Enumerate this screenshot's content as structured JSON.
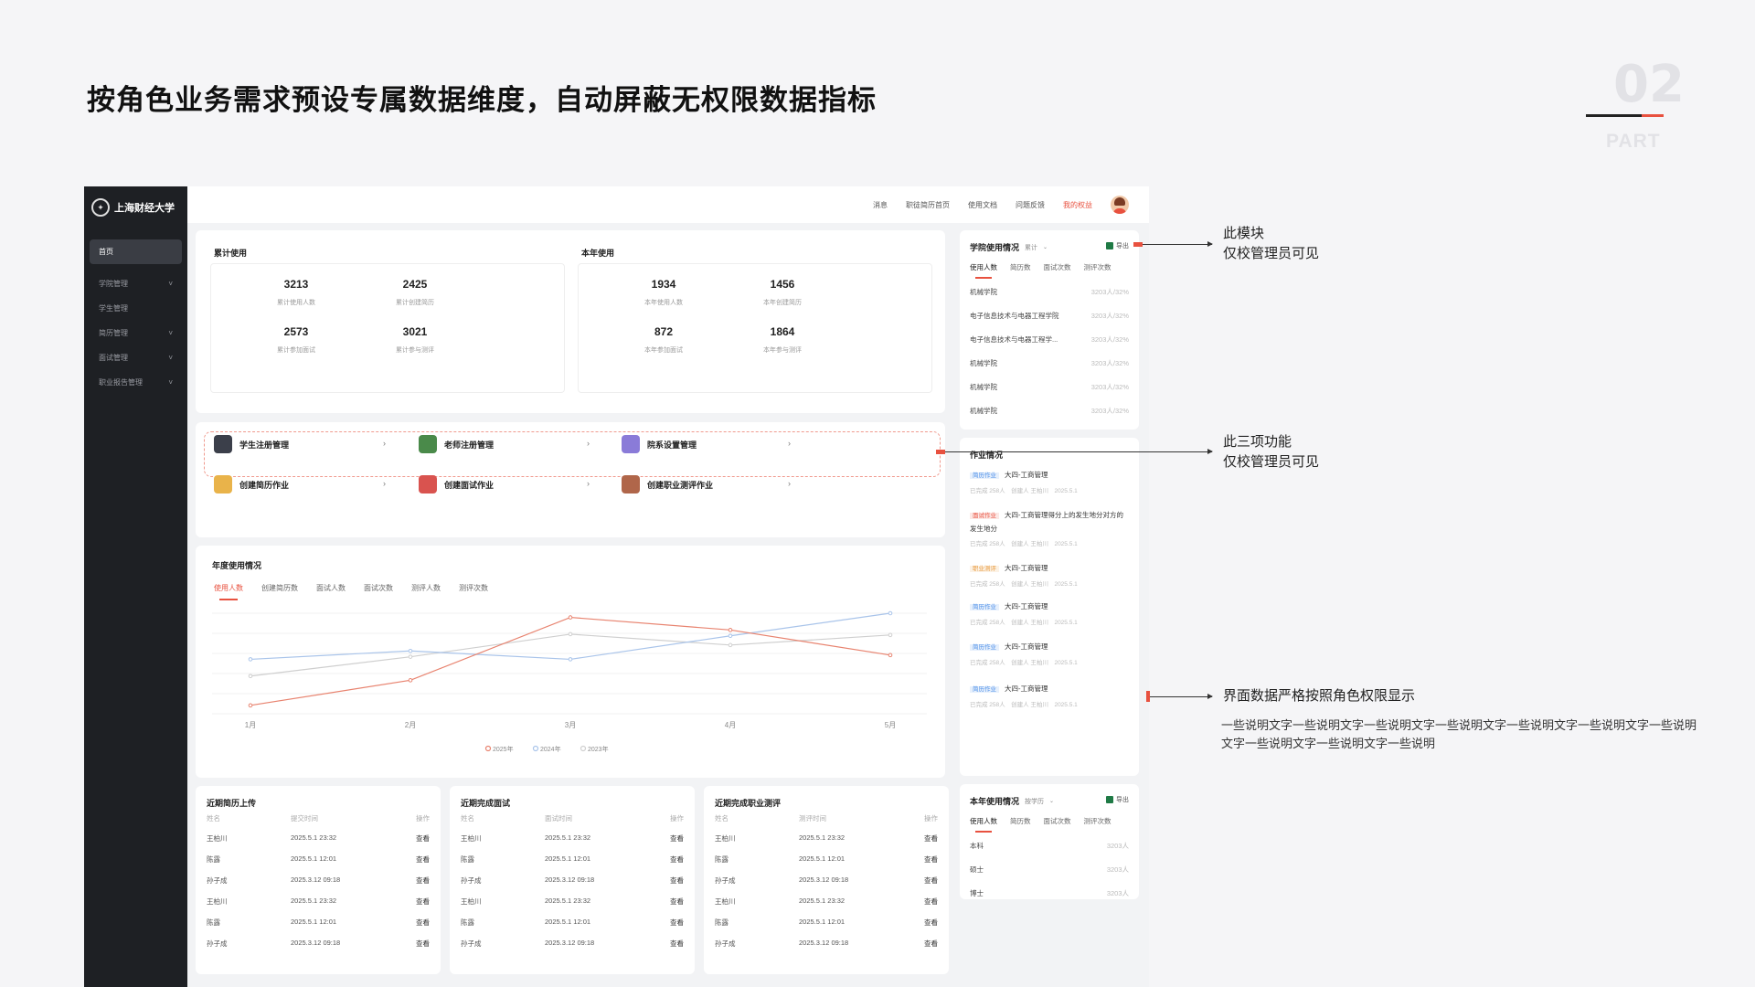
{
  "slide": {
    "headline": "按角色业务需求预设专属数据维度，自动屏蔽无权限数据指标",
    "part_number": "02",
    "part_word": "PART"
  },
  "sidebar": {
    "logo_text": "上海财经大学",
    "items": [
      {
        "label": "首页",
        "arrow": ""
      },
      {
        "label": "学院管理",
        "arrow": "˅"
      },
      {
        "label": "学生管理",
        "arrow": ""
      },
      {
        "label": "简历管理",
        "arrow": "˅"
      },
      {
        "label": "面试管理",
        "arrow": "˅"
      },
      {
        "label": "职业报告管理",
        "arrow": "˅"
      }
    ]
  },
  "topbar": {
    "links": [
      "消息",
      "职徒简历首页",
      "使用文档",
      "问题反馈"
    ],
    "my_rights": "我的权益"
  },
  "usage": {
    "cumulative": {
      "title": "累计使用",
      "stats": [
        {
          "value": "3213",
          "label": "累计使用人数"
        },
        {
          "value": "2425",
          "label": "累计创建简历"
        },
        {
          "value": "2573",
          "label": "累计参加面试"
        },
        {
          "value": "3021",
          "label": "累计参与测评"
        }
      ]
    },
    "this_year": {
      "title": "本年使用",
      "stats": [
        {
          "value": "1934",
          "label": "本年使用人数"
        },
        {
          "value": "1456",
          "label": "本年创建简历"
        },
        {
          "value": "872",
          "label": "本年参加面试"
        },
        {
          "value": "1864",
          "label": "本年参与测评"
        }
      ]
    }
  },
  "quick_actions": [
    {
      "label": "学生注册管理",
      "color": "#3b3f4a"
    },
    {
      "label": "老师注册管理",
      "color": "#4a8a4a"
    },
    {
      "label": "院系设置管理",
      "color": "#8a7bd8"
    },
    {
      "label": "创建简历作业",
      "color": "#e9b34a"
    },
    {
      "label": "创建面试作业",
      "color": "#d9534f"
    },
    {
      "label": "创建职业测评作业",
      "color": "#b0664a"
    }
  ],
  "annual": {
    "title": "年度使用情况",
    "tabs": [
      "使用人数",
      "创建简历数",
      "面试人数",
      "面试次数",
      "测评人数",
      "测评次数"
    ]
  },
  "chart_data": {
    "type": "line",
    "categories": [
      "1月",
      "2月",
      "3月",
      "4月",
      "5月"
    ],
    "series": [
      {
        "name": "2025年",
        "color": "#e8836f",
        "values": [
          10,
          40,
          115,
          100,
          70
        ]
      },
      {
        "name": "2024年",
        "color": "#a9c4ea",
        "values": [
          65,
          75,
          65,
          93,
          120
        ]
      },
      {
        "name": "2023年",
        "color": "#cfcfcf",
        "values": [
          45,
          68,
          95,
          82,
          94
        ]
      }
    ],
    "grid": true,
    "legend": "bottom-center"
  },
  "recent_tables": [
    {
      "title": "近期简历上传",
      "headers": [
        "姓名",
        "提交时间",
        "操作"
      ],
      "rows": [
        [
          "王柏川",
          "2025.5.1 23:32",
          "查看"
        ],
        [
          "陈露",
          "2025.5.1 12:01",
          "查看"
        ],
        [
          "孙子成",
          "2025.3.12 09:18",
          "查看"
        ],
        [
          "王柏川",
          "2025.5.1 23:32",
          "查看"
        ],
        [
          "陈露",
          "2025.5.1 12:01",
          "查看"
        ],
        [
          "孙子成",
          "2025.3.12 09:18",
          "查看"
        ]
      ]
    },
    {
      "title": "近期完成面试",
      "headers": [
        "姓名",
        "面试时间",
        "操作"
      ],
      "rows": [
        [
          "王柏川",
          "2025.5.1 23:32",
          "查看"
        ],
        [
          "陈露",
          "2025.5.1 12:01",
          "查看"
        ],
        [
          "孙子成",
          "2025.3.12 09:18",
          "查看"
        ],
        [
          "王柏川",
          "2025.5.1 23:32",
          "查看"
        ],
        [
          "陈露",
          "2025.5.1 12:01",
          "查看"
        ],
        [
          "孙子成",
          "2025.3.12 09:18",
          "查看"
        ]
      ]
    },
    {
      "title": "近期完成职业测评",
      "headers": [
        "姓名",
        "测评时间",
        "操作"
      ],
      "rows": [
        [
          "王柏川",
          "2025.5.1 23:32",
          "查看"
        ],
        [
          "陈露",
          "2025.5.1 12:01",
          "查看"
        ],
        [
          "孙子成",
          "2025.3.12 09:18",
          "查看"
        ],
        [
          "王柏川",
          "2025.5.1 23:32",
          "查看"
        ],
        [
          "陈露",
          "2025.5.1 12:01",
          "查看"
        ],
        [
          "孙子成",
          "2025.3.12 09:18",
          "查看"
        ]
      ]
    }
  ],
  "college_usage": {
    "title": "学院使用情况",
    "filter": "累计",
    "export": "导出",
    "tabs": [
      "使用人数",
      "简历数",
      "面试次数",
      "测评次数"
    ],
    "rows": [
      {
        "name": "机械学院",
        "value": "3203人/32%"
      },
      {
        "name": "电子信息技术与电器工程学院",
        "value": "3203人/32%"
      },
      {
        "name": "电子信息技术与电器工程学...",
        "value": "3203人/32%"
      },
      {
        "name": "机械学院",
        "value": "3203人/32%"
      },
      {
        "name": "机械学院",
        "value": "3203人/32%"
      },
      {
        "name": "机械学院",
        "value": "3203人/32%"
      }
    ]
  },
  "homework": {
    "title": "作业情况",
    "items": [
      {
        "badge": "简历作业",
        "badge_color": "#4a8ee8",
        "title": "大四-工商管理",
        "meta": "已完成 258人　创建人 王柏川　2025.5.1"
      },
      {
        "badge": "面试作业",
        "badge_color": "#e8513f",
        "title": "大四-工商管理得分上的发生地分对方的发生地分",
        "meta": "已完成 258人　创建人 王柏川　2025.5.1"
      },
      {
        "badge": "职业测评",
        "badge_color": "#e89a3f",
        "title": "大四-工商管理",
        "meta": "已完成 258人　创建人 王柏川　2025.5.1"
      },
      {
        "badge": "简历作业",
        "badge_color": "#4a8ee8",
        "title": "大四-工商管理",
        "meta": "已完成 258人　创建人 王柏川　2025.5.1"
      },
      {
        "badge": "简历作业",
        "badge_color": "#4a8ee8",
        "title": "大四-工商管理",
        "meta": "已完成 258人　创建人 王柏川　2025.5.1"
      },
      {
        "badge": "简历作业",
        "badge_color": "#4a8ee8",
        "title": "大四-工商管理",
        "meta": "已完成 258人　创建人 王柏川　2025.5.1"
      }
    ]
  },
  "year_usage": {
    "title": "本年使用情况",
    "filter": "按学历",
    "export": "导出",
    "tabs": [
      "使用人数",
      "简历数",
      "面试次数",
      "测评次数"
    ],
    "rows": [
      {
        "name": "本科",
        "value": "3203人"
      },
      {
        "name": "硕士",
        "value": "3203人"
      },
      {
        "name": "博士",
        "value": "3203人"
      }
    ]
  },
  "annotations": {
    "note1": [
      "此模块",
      "仅校管理员可见"
    ],
    "note2": [
      "此三项功能",
      "仅校管理员可见"
    ],
    "note3": "界面数据严格按照角色权限显示",
    "note3_desc": "一些说明文字一些说明文字一些说明文字一些说明文字一些说明文字一些说明文字一些说明文字一些说明文字一些说明文字一些说明"
  },
  "colors": {
    "accent": "#e8513f",
    "sidebar": "#1e2024"
  }
}
